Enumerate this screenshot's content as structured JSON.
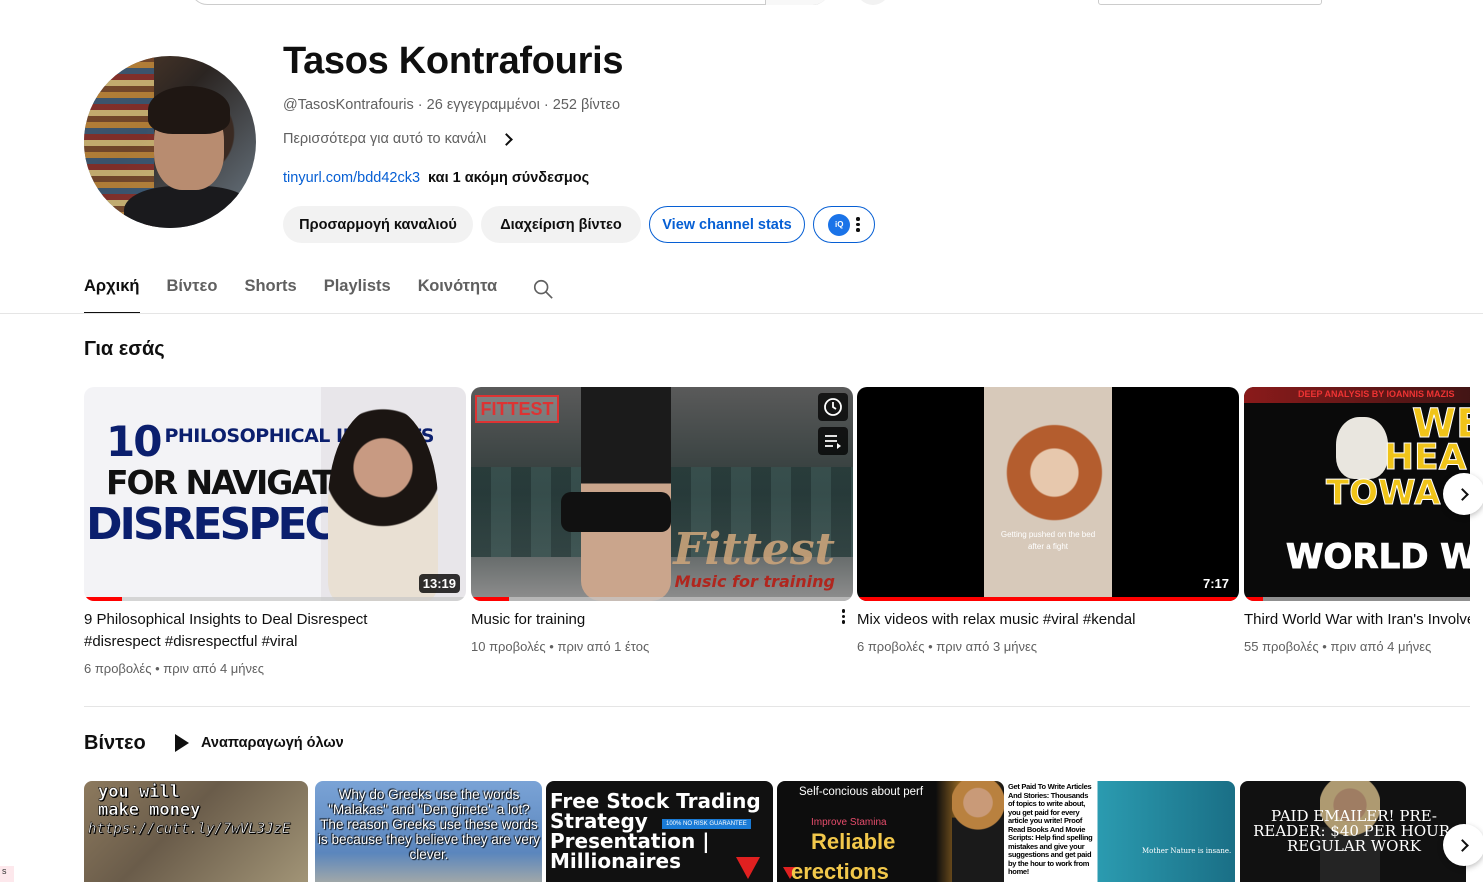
{
  "channel": {
    "name": "Tasos Kontrafouris",
    "handle": "@TasosKontrafouris",
    "meta_sep": " · ",
    "subscribers": "26 εγγεγραμμένοι",
    "video_count": "252 βίντεο",
    "more_about": "Περισσότερα για αυτό το κανάλι",
    "link": "tinyurl.com/bdd42ck3",
    "more_links": "και 1 ακόμη σύνδεσμος"
  },
  "actions": {
    "customize": "Προσαρμογή καναλιού",
    "manage_videos": "Διαχείριση βίντεο",
    "view_stats": "View channel stats",
    "extension_label": "iQ"
  },
  "tabs": [
    {
      "label": "Αρχική",
      "active": true
    },
    {
      "label": "Βίντεο",
      "active": false
    },
    {
      "label": "Shorts",
      "active": false
    },
    {
      "label": "Playlists",
      "active": false
    },
    {
      "label": "Κοινότητα",
      "active": false
    }
  ],
  "for_you": {
    "title": "Για εσάς",
    "videos": [
      {
        "title": "9 Philosophical Insights to Deal Disrespect #disrespect #disrespectful #viral",
        "views": "6 προβολές",
        "age": "πριν από 4 μήνες",
        "duration": "13:19",
        "watched_fraction": 0.1,
        "thumb_text": {
          "line1_num": "10",
          "line1": "PHILOSOPHICAL INSIGHTS",
          "line2": "FOR NAVIGATING",
          "line3": "DISRESPECT"
        }
      },
      {
        "title": "Music for training",
        "views": "10 προβολές",
        "age": "πριν από 1 έτος",
        "duration": "",
        "watched_fraction": 0.1,
        "thumb_text": {
          "logo": "FITTEST",
          "brand": "Fittest",
          "brand2": "Music for training"
        }
      },
      {
        "title": "Mix videos with relax music #viral #kendal",
        "views": "6 προβολές",
        "age": "πριν από 3 μήνες",
        "duration": "7:17",
        "watched_fraction": 1.0,
        "thumb_text": {
          "caption": "Getting pushed on the bed after a fight"
        }
      },
      {
        "title": "Third World War with Iran's Involvement to Ioannis Mazis",
        "views": "55 προβολές",
        "age": "πριν από 4 μήνες",
        "duration": "",
        "watched_fraction": 0.05,
        "thumb_text": {
          "banner": "DEEP ANALYSIS BY IOANNIS MAZIS",
          "w1": "WE",
          "w2": "HEA",
          "w3": "TOWA",
          "w4": "WORLD W"
        }
      }
    ]
  },
  "videos_section": {
    "title": "Βίντεο",
    "play_all": "Αναπαραγωγή όλων",
    "thumbs": [
      {
        "line1": "you will",
        "line2": "make money",
        "url": "https://cutt.ly/7wVL3JzE"
      },
      {
        "text": "Why do Greeks use the words \"Malakas\" and \"Den ginete\" a lot? The reason Greeks use these words is because they believe they are very clever."
      },
      {
        "text": "Free Stock Trading Strategy Presentation | Millionaires",
        "badge": "100% NO RISK GUARANTEE"
      },
      {
        "a": "Self-concious about perf",
        "b": "Improve Stamina",
        "c": "Reliable",
        "d": "erections"
      },
      {
        "text": "Get Paid To Write Articles And Stories: Thousands of topics to write about, you get paid for every article you write! Proof Read Books And Movie Scripts: Help find spelling mistakes and give your suggestions and get paid by the hour to work from home!",
        "caption": "Mother Nature is insane."
      },
      {
        "text": "PAID EMAILER! PRE-READER: $40 PER HOUR, REGULAR WORK"
      }
    ]
  },
  "corner_tag": "s",
  "colors": {
    "accent_blue": "#065fd4",
    "progress_red": "#ff0000",
    "text_secondary": "#606060"
  }
}
